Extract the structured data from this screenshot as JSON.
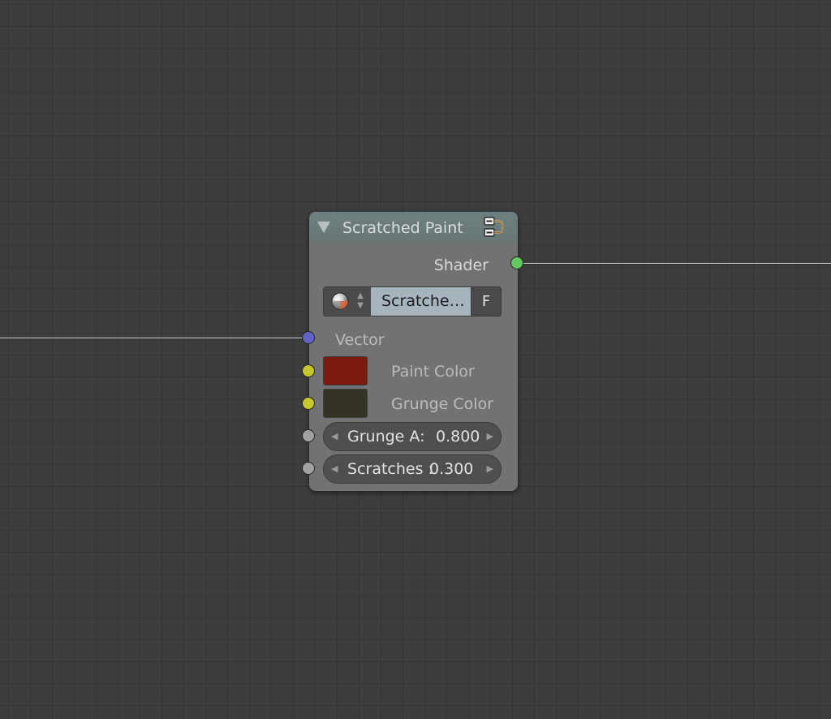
{
  "node": {
    "title": "Scratched Paint",
    "header_color": "#6f8080",
    "body_color": "#727272",
    "outputs": [
      {
        "label": "Shader",
        "socket_color": "#63c763"
      }
    ],
    "datablock": {
      "name": "Scratche…",
      "fake_user": "F"
    },
    "inputs": {
      "vector": {
        "label": "Vector",
        "socket_color": "#6363c7"
      },
      "paint_color": {
        "label": "Paint Color",
        "socket_color": "#c7c729",
        "swatch": "#7a1a0e"
      },
      "grunge_color": {
        "label": "Grunge Color",
        "socket_color": "#c7c729",
        "swatch": "#343325"
      },
      "grunge_a": {
        "label": "Grunge A:",
        "value": "0.800",
        "socket_color": "#a1a1a1"
      },
      "scratches": {
        "label": "Scratches :",
        "value": "0.300",
        "socket_color": "#a1a1a1"
      }
    }
  }
}
